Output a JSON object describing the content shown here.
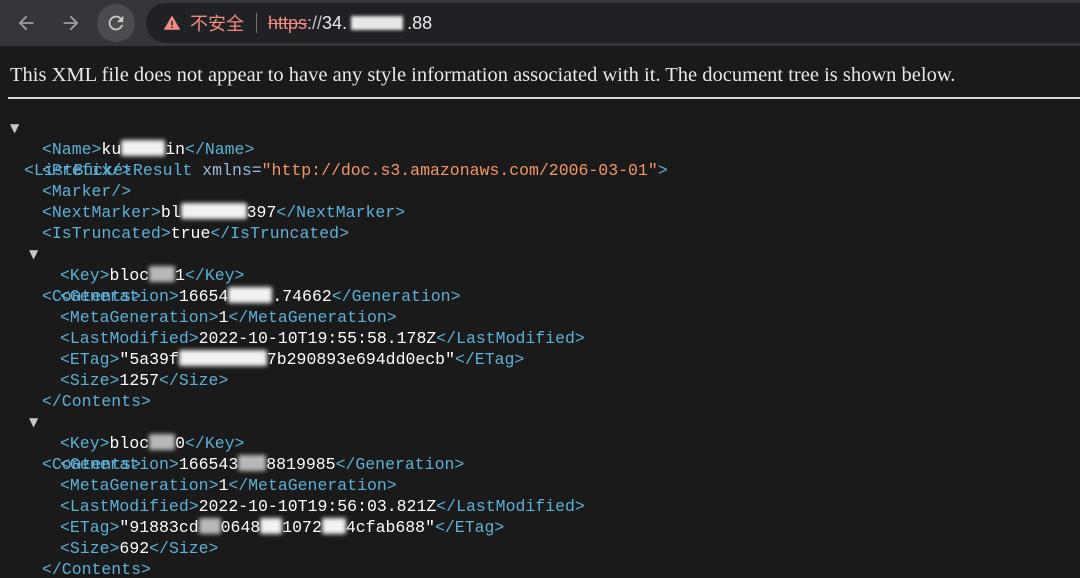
{
  "browser": {
    "security_label": "不安全",
    "url_scheme": "https",
    "url_scheme_sep": "://",
    "url_host_start": "34.",
    "url_host_end": ".88"
  },
  "notice": "This XML file does not appear to have any style information associated with it. The document tree is shown below.",
  "xml": {
    "root_open": "<ListBucketResult",
    "root_attr": "xmlns=",
    "root_attr_value": "\"http://doc.s3.amazonaws.com/2006-03-01\"",
    "root_close_bracket": ">",
    "name_open": "<Name>",
    "name_start": "ku",
    "name_end": "in",
    "name_close": "</Name>",
    "prefix": "<Prefix/>",
    "marker": "<Marker/>",
    "nextmarker_open": "<NextMarker>",
    "nextmarker_start": "bl",
    "nextmarker_end": "397",
    "nextmarker_close": "</NextMarker>",
    "istruncated_open": "<IsTruncated>",
    "istruncated_value": "true",
    "istruncated_close": "</IsTruncated>",
    "contents_open": "<Contents>",
    "contents_close": "</Contents>",
    "contents": [
      {
        "key_start": "bloc",
        "key_end": "1",
        "generation_start": "16654",
        "generation_end": ".74662",
        "metageneration": "1",
        "lastmodified": "2022-10-10T19:55:58.178Z",
        "etag_start": "\"5a39f",
        "etag_end": "7b290893e694dd0ecb\"",
        "size": "1257"
      },
      {
        "key_start": "bloc",
        "key_end": "0",
        "generation_start": "166543",
        "generation_end": "8819985",
        "metageneration": "1",
        "lastmodified": "2022-10-10T19:56:03.821Z",
        "etag_start": "\"91883cd",
        "etag_mid1": "0648",
        "etag_mid2": "1072",
        "etag_end": "4cfab688\"",
        "size": "692"
      }
    ]
  }
}
